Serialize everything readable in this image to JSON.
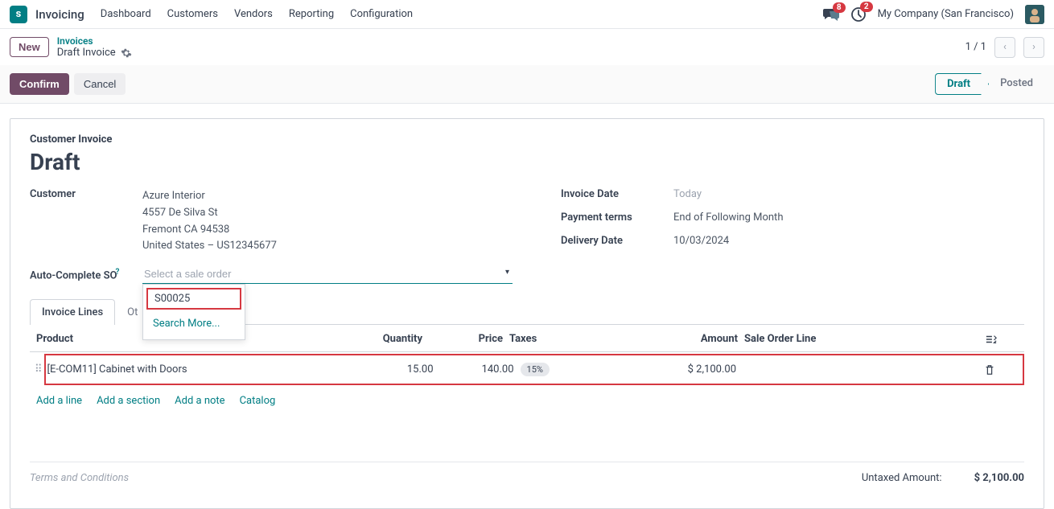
{
  "topbar": {
    "app_name": "Invoicing",
    "menu": [
      "Dashboard",
      "Customers",
      "Vendors",
      "Reporting",
      "Configuration"
    ],
    "chat_badge": "8",
    "clock_badge": "2",
    "company": "My Company (San Francisco)"
  },
  "subbar": {
    "new_label": "New",
    "bc_link": "Invoices",
    "bc_current": "Draft Invoice",
    "pager": "1 / 1"
  },
  "actions": {
    "confirm": "Confirm",
    "cancel": "Cancel",
    "status_draft": "Draft",
    "status_posted": "Posted"
  },
  "form": {
    "title": "Customer Invoice",
    "heading": "Draft",
    "left": {
      "customer_label": "Customer",
      "customer_name": "Azure Interior",
      "addr1": "4557 De Silva St",
      "addr2": "Fremont CA 94538",
      "addr3": "United States – US12345677",
      "ac_label": "Auto-Complete SO",
      "ac_placeholder": "Select a sale order"
    },
    "right": {
      "inv_date_label": "Invoice Date",
      "inv_date_val": "Today",
      "pay_terms_label": "Payment terms",
      "pay_terms_val": "End of Following Month",
      "del_date_label": "Delivery Date",
      "del_date_val": "10/03/2024"
    },
    "dropdown": {
      "option": "S00025",
      "search_more": "Search More..."
    },
    "tabs": {
      "lines": "Invoice Lines",
      "other_prefix": "Ot"
    },
    "columns": {
      "product": "Product",
      "qty": "Quantity",
      "price": "Price",
      "taxes": "Taxes",
      "amount": "Amount",
      "sol": "Sale Order Line"
    },
    "row": {
      "product": "[E-COM11] Cabinet with Doors",
      "qty": "15.00",
      "price": "140.00",
      "tax": "15%",
      "amount": "$ 2,100.00"
    },
    "line_actions": {
      "add_line": "Add a line",
      "add_section": "Add a section",
      "add_note": "Add a note",
      "catalog": "Catalog"
    },
    "terms_placeholder": "Terms and Conditions",
    "totals": {
      "untaxed_label": "Untaxed Amount:",
      "untaxed_val": "$ 2,100.00"
    }
  }
}
